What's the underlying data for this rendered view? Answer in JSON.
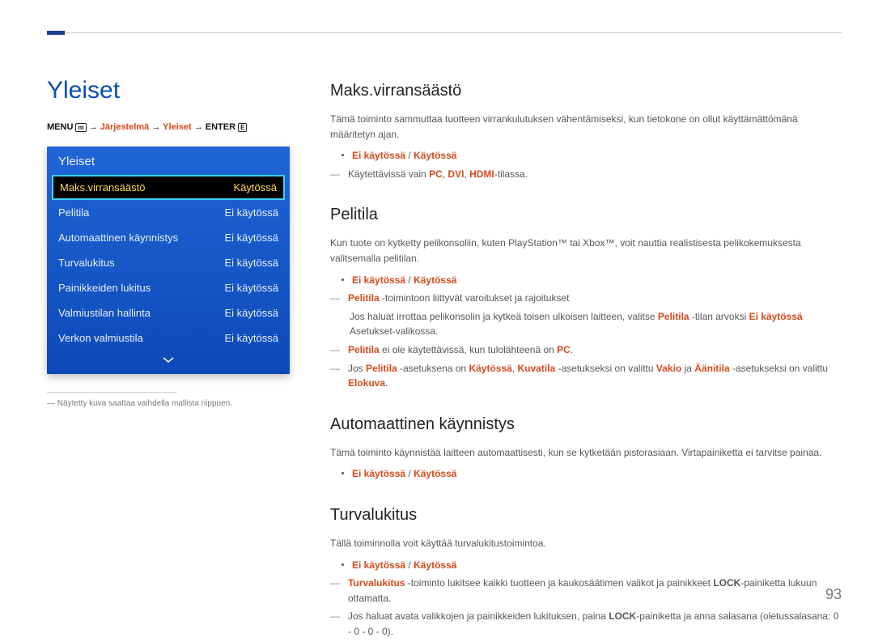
{
  "page_number": "93",
  "left": {
    "title": "Yleiset",
    "breadcrumb": {
      "menu_label": "MENU",
      "menu_icon": "m",
      "arrow": "→",
      "seg1": "Järjestelmä",
      "seg2": "Yleiset",
      "enter_label": "ENTER",
      "enter_icon": "E"
    },
    "panel_title": "Yleiset",
    "rows": [
      {
        "label": "Maks.virransäästö",
        "value": "Käytössä",
        "selected": true
      },
      {
        "label": "Pelitila",
        "value": "Ei käytössä"
      },
      {
        "label": "Automaattinen käynnistys",
        "value": "Ei käytössä"
      },
      {
        "label": "Turvalukitus",
        "value": "Ei käytössä"
      },
      {
        "label": "Painikkeiden lukitus",
        "value": "Ei käytössä"
      },
      {
        "label": "Valmiustilan hallinta",
        "value": "Ei käytössä"
      },
      {
        "label": "Verkon valmiustila",
        "value": "Ei käytössä"
      }
    ],
    "footnote": "Näytetty kuva saattaa vaihdella mallista riippuen."
  },
  "right": {
    "s1": {
      "h": "Maks.virransäästö",
      "p1": "Tämä toiminto sammuttaa tuotteen virrankulutuksen vähentämiseksi, kun tietokone on ollut käyttämättömänä määritetyn ajan.",
      "bul1_a": "Ei käytössä",
      "bul1_sep": " / ",
      "bul1_b": "Käytössä",
      "d1_pre": "Käytettävissä vain ",
      "d1_pc": "PC",
      "d1_c1": ", ",
      "d1_dvi": "DVI",
      "d1_c2": ", ",
      "d1_hdmi": "HDMI",
      "d1_post": "-tilassa."
    },
    "s2": {
      "h": "Pelitila",
      "p1": "Kun tuote on kytketty pelikonsoliin, kuten PlayStation™ tai Xbox™, voit nauttia realistisesta pelikokemuksesta valitsemalla pelitilan.",
      "bul1_a": "Ei käytössä",
      "bul1_sep": " / ",
      "bul1_b": "Käytössä",
      "d1_lbl": "Pelitila",
      "d1_post": " -toimintoon liittyvät varoitukset ja rajoitukset",
      "d1sub_pre": "Jos haluat irrottaa pelikonsolin ja kytkeä toisen ulkoisen laitteen, valitse ",
      "d1sub_lbl": "Pelitila",
      "d1sub_mid": " -tilan arvoksi ",
      "d1sub_val": "Ei käytössä",
      "d1sub_post": " Asetukset-valikossa.",
      "d2_lbl": "Pelitila",
      "d2_mid": " ei ole käytettävissä, kun tulolähteenä on ",
      "d2_pc": "PC",
      "d2_end": ".",
      "d3_pre": "Jos ",
      "d3_lbl1": "Pelitila",
      "d3_mid1": " -asetuksena on ",
      "d3_v1": "Käytössä",
      "d3_mid2": ", ",
      "d3_lbl2": "Kuvatila",
      "d3_mid3": " -asetukseksi on valittu ",
      "d3_v2": "Vakio",
      "d3_mid4": " ja ",
      "d3_lbl3": "Äänitila",
      "d3_mid5": " -asetukseksi on valittu ",
      "d3_v3": "Elokuva",
      "d3_end": "."
    },
    "s3": {
      "h": "Automaattinen käynnistys",
      "p1": "Tämä toiminto käynnistää laitteen automaattisesti, kun se kytketään pistorasiaan. Virtapainiketta ei tarvitse painaa.",
      "bul1_a": "Ei käytössä",
      "bul1_sep": " / ",
      "bul1_b": "Käytössä"
    },
    "s4": {
      "h": "Turvalukitus",
      "p1": "Tällä toiminnolla voit käyttää turvalukitustoimintoa.",
      "bul1_a": "Ei käytössä",
      "bul1_sep": " / ",
      "bul1_b": "Käytössä",
      "d1_lbl": "Turvalukitus",
      "d1_mid": " -toiminto lukitsee kaikki tuotteen ja kaukosäätimen valikot ja painikkeet ",
      "d1_lock": "LOCK",
      "d1_post": "-painiketta lukuun ottamatta.",
      "d2_pre": "Jos haluat avata valikkojen ja painikkeiden lukituksen, paina ",
      "d2_lock": "LOCK",
      "d2_post": "-painiketta ja anna salasana (oletussalasana: 0 - 0 - 0 - 0)."
    }
  }
}
